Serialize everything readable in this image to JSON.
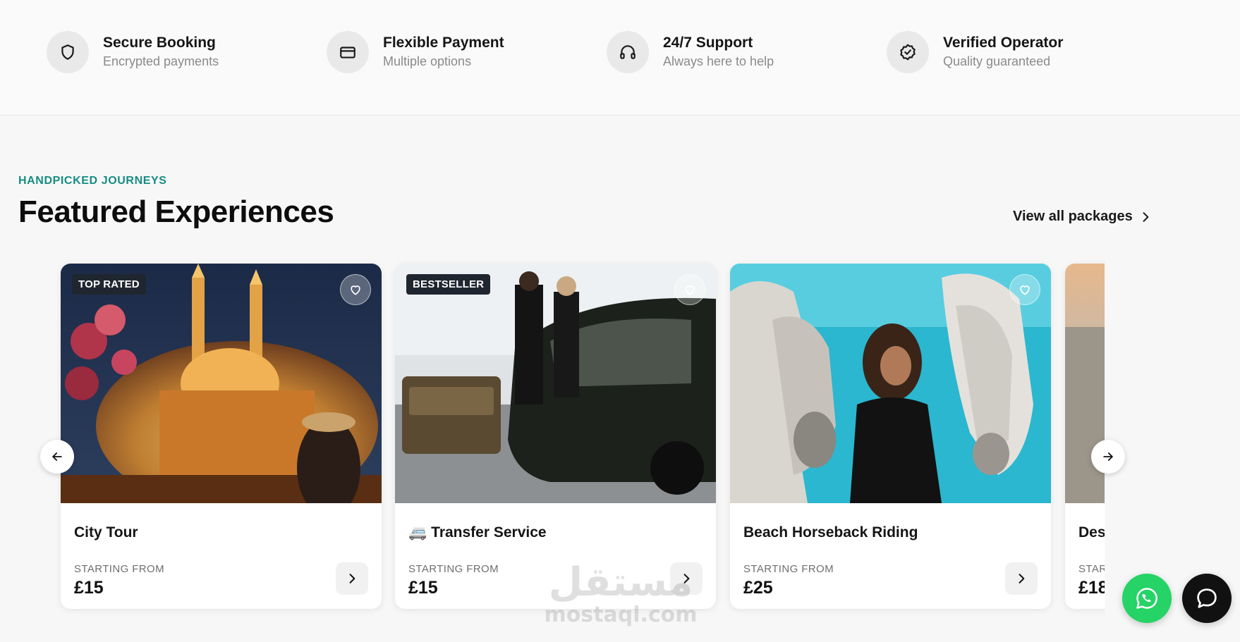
{
  "trust": [
    {
      "icon": "shield-icon",
      "title": "Secure Booking",
      "subtitle": "Encrypted payments"
    },
    {
      "icon": "credit-card-icon",
      "title": "Flexible Payment",
      "subtitle": "Multiple options"
    },
    {
      "icon": "headphones-icon",
      "title": "24/7 Support",
      "subtitle": "Always here to help"
    },
    {
      "icon": "verified-badge-icon",
      "title": "Verified Operator",
      "subtitle": "Quality guaranteed"
    }
  ],
  "section": {
    "eyebrow": "HANDPICKED JOURNEYS",
    "title": "Featured Experiences",
    "view_all": "View all packages"
  },
  "cards": [
    {
      "badge": "TOP RATED",
      "title": "City Tour",
      "emoji": "",
      "from_label": "STARTING FROM",
      "price": "£15"
    },
    {
      "badge": "BESTSELLER",
      "title": "Transfer Service",
      "emoji": "🚐",
      "from_label": "STARTING FROM",
      "price": "£15"
    },
    {
      "badge": "",
      "title": "Beach Horseback Riding",
      "emoji": "",
      "from_label": "STARTING FROM",
      "price": "£25"
    },
    {
      "badge": "",
      "title": "Des",
      "emoji": "",
      "from_label": "STAR",
      "price": "£18"
    }
  ],
  "watermark": {
    "arabic": "مستقل",
    "latin": "mostaql.com"
  },
  "colors": {
    "accent": "#168c82",
    "badge_bg": "#1f2630",
    "whatsapp": "#25d366",
    "chat": "#111111"
  }
}
